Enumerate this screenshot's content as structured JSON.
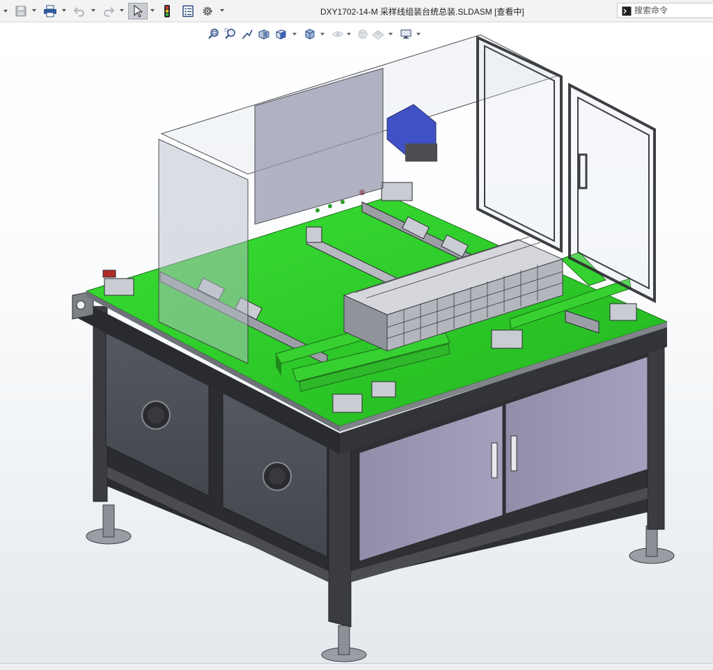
{
  "window": {
    "title": "DXY1702-14-M 采样线组装台统总装.SLDASM [查看中]"
  },
  "toolbar": {
    "items": [
      {
        "name": "save",
        "icon": "save-icon"
      },
      {
        "name": "print",
        "icon": "print-icon"
      },
      {
        "name": "undo",
        "icon": "undo-icon"
      },
      {
        "name": "redo",
        "icon": "redo-icon"
      },
      {
        "name": "select",
        "icon": "cursor-icon"
      },
      {
        "name": "rebuild",
        "icon": "traffic-light-icon"
      },
      {
        "name": "file-properties",
        "icon": "properties-icon"
      },
      {
        "name": "options",
        "icon": "gear-icon"
      }
    ]
  },
  "search": {
    "placeholder": "搜索命令"
  },
  "view_toolbar": {
    "items": [
      {
        "name": "zoom-to-fit",
        "icon": "zoom-fit-icon"
      },
      {
        "name": "zoom-to-area",
        "icon": "zoom-area-icon"
      },
      {
        "name": "previous-view",
        "icon": "previous-view-icon"
      },
      {
        "name": "section-view",
        "icon": "section-view-icon"
      },
      {
        "name": "view-orientation",
        "icon": "view-orientation-icon"
      },
      {
        "name": "display-style",
        "icon": "display-style-icon"
      },
      {
        "name": "hide-show-items",
        "icon": "hide-show-icon"
      },
      {
        "name": "edit-appearance",
        "icon": "appearance-icon"
      },
      {
        "name": "apply-scene",
        "icon": "scene-icon"
      },
      {
        "name": "view-settings",
        "icon": "monitor-icon"
      }
    ]
  },
  "colors": {
    "table_top": "#2fd12a",
    "frame": "#3a3c40",
    "panel": "#8d8ba6",
    "door_panel": "#9a98b6",
    "glass": "#c9d3e6",
    "accent_blue": "#2b3fbf"
  }
}
